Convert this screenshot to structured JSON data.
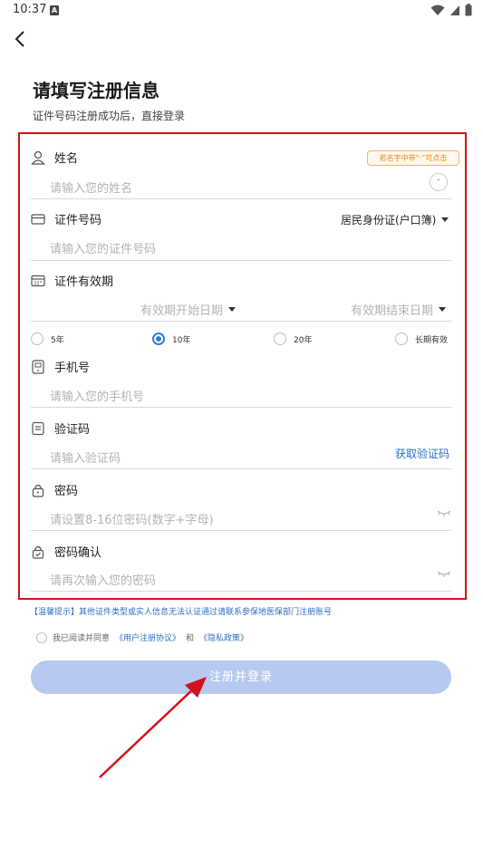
{
  "status_bar": {
    "time": "10:37",
    "notification_letter": "A"
  },
  "header": {
    "title": "请填写注册信息",
    "subtitle": "证件号码注册成功后，直接登录"
  },
  "name_field": {
    "label": "姓名",
    "placeholder": "请输入您的姓名",
    "hint": "若名字中带“·”可点击",
    "dot_button": "·"
  },
  "id_field": {
    "label": "证件号码",
    "id_type": "居民身份证(户口簿)",
    "placeholder": "请输入您的证件号码"
  },
  "validity_field": {
    "label": "证件有效期",
    "start_placeholder": "有效期开始日期",
    "end_placeholder": "有效期结束日期",
    "options": [
      "5年",
      "10年",
      "20年",
      "长期有效"
    ],
    "selected": "10年"
  },
  "phone_field": {
    "label": "手机号",
    "placeholder": "请输入您的手机号"
  },
  "code_field": {
    "label": "验证码",
    "placeholder": "请输入验证码",
    "get_code": "获取验证码"
  },
  "password_field": {
    "label": "密码",
    "placeholder": "请设置8-16位密码(数字+字母)"
  },
  "confirm_field": {
    "label": "密码确认",
    "placeholder": "请再次输入您的密码"
  },
  "tip": "【温馨提示】其他证件类型或实人信息无法认证通过请联系参保地医保部门注册账号",
  "agreement": {
    "prefix": "我已阅读并同意",
    "user_agreement": "《用户注册协议》",
    "and": "和",
    "privacy": "《隐私政策》"
  },
  "submit_label": "注册并登录",
  "colors": {
    "accent": "#2f6fc4",
    "frame": "#d0121b",
    "button": "#b7c9f1",
    "arrow": "#d0121b"
  }
}
